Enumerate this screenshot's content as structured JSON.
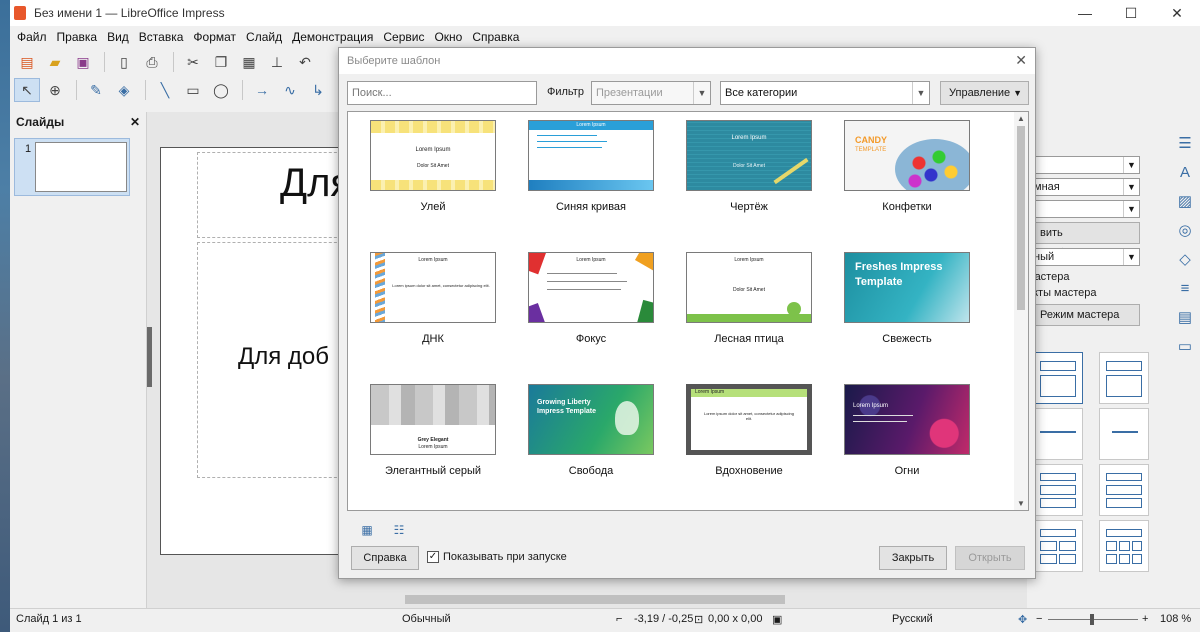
{
  "window": {
    "title": "Без имени 1 — LibreOffice Impress",
    "minimize": "—",
    "maximize": "☐",
    "close": "✕"
  },
  "menu": [
    "Файл",
    "Правка",
    "Вид",
    "Вставка",
    "Формат",
    "Слайд",
    "Демонстрация",
    "Сервис",
    "Окно",
    "Справка"
  ],
  "slides_panel": {
    "title": "Слайды",
    "close": "✕",
    "slide_number": "1"
  },
  "slide": {
    "title_text": "Для",
    "body_text": "Для доб"
  },
  "sidebar": {
    "field1": "",
    "field2": "мная",
    "field3": "",
    "image_button": "вить изображение...",
    "field4": "ный",
    "check1": "мастера",
    "check2": "екты мастера",
    "master_mode_button": "Режим мастера"
  },
  "status": {
    "slide_info": "Слайд 1 из 1",
    "mode": "Обычный",
    "position": "-3,19 / -0,25",
    "size": "0,00 x 0,00",
    "language": "Русский",
    "zoom": "108 %"
  },
  "dialog": {
    "title": "Выберите шаблон",
    "close": "✕",
    "search_placeholder": "Поиск...",
    "filter_label": "Фильтр",
    "filter_value": "Презентации",
    "category_value": "Все категории",
    "manage_label": "Управление",
    "help_label": "Справка",
    "show_at_startup": "Показывать при запуске",
    "show_at_startup_checked": true,
    "close_label": "Закрыть",
    "open_label": "Открыть",
    "templates": [
      {
        "name": "Улей",
        "lines": [
          "Lorem Ipsum",
          "Dolor Sit Amet"
        ]
      },
      {
        "name": "Синяя кривая",
        "lines": [
          "Lorem Ipsum"
        ]
      },
      {
        "name": "Чертёж",
        "lines": [
          "Lorem Ipsum",
          "Dolor Sit Amet"
        ]
      },
      {
        "name": "Конфетки",
        "lines": [
          "CANDY",
          "TEMPLATE"
        ]
      },
      {
        "name": "ДНК",
        "lines": [
          "Lorem Ipsum",
          "Lorem ipsum dolor sit amet, consectetur adipiscing elit."
        ]
      },
      {
        "name": "Фокус",
        "lines": [
          "Lorem Ipsum"
        ]
      },
      {
        "name": "Лесная птица",
        "lines": [
          "Lorem Ipsum",
          "Dolor Sit Amet"
        ]
      },
      {
        "name": "Свежесть",
        "lines": [
          "Freshes Impress",
          "Template"
        ]
      },
      {
        "name": "Элегантный серый",
        "lines": [
          "Grey Elegant",
          "Lorem Ipsum"
        ]
      },
      {
        "name": "Свобода",
        "lines": [
          "Growing Liberty",
          "Impress Template"
        ]
      },
      {
        "name": "Вдохновение",
        "lines": [
          "Lorem Ipsum",
          "Lorem ipsum dolor sit amet, consectetur adipiscing elit."
        ]
      },
      {
        "name": "Огни",
        "lines": [
          "Lorem Ipsum"
        ]
      }
    ]
  }
}
